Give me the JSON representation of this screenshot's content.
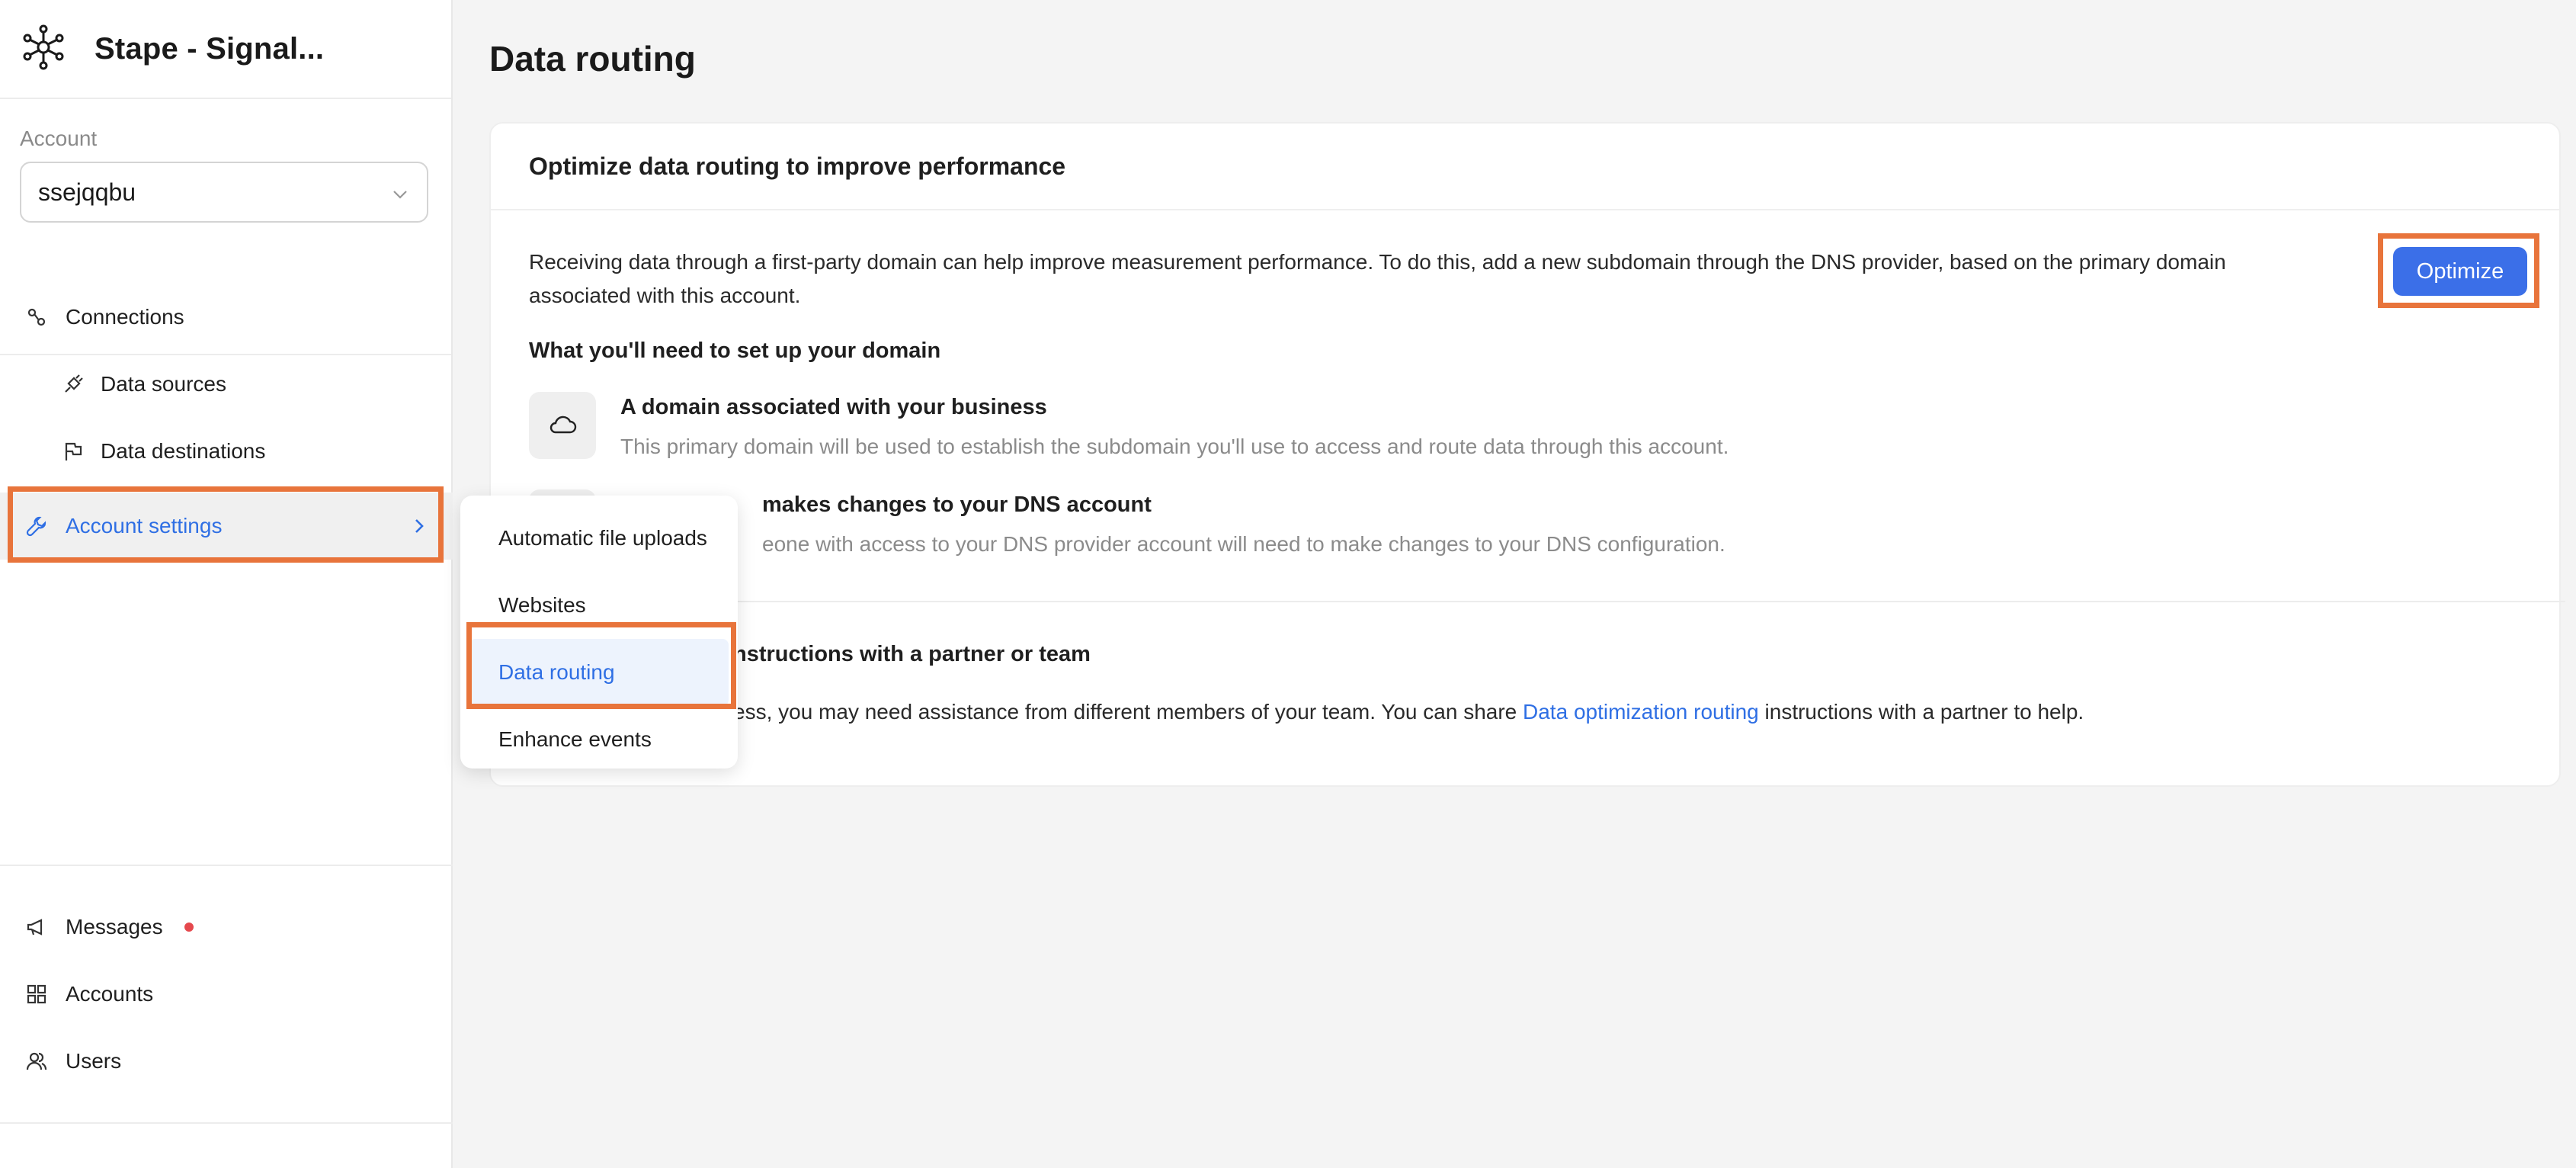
{
  "app": {
    "title": "Stape - Signal..."
  },
  "account": {
    "label": "Account",
    "selected": "ssejqqbu"
  },
  "sidebar": {
    "connections": "Connections",
    "data_sources": "Data sources",
    "data_destinations": "Data destinations",
    "account_settings": "Account settings",
    "messages": "Messages",
    "accounts": "Accounts",
    "users": "Users"
  },
  "submenu": {
    "items": [
      {
        "label": "Automatic file uploads"
      },
      {
        "label": "Websites"
      },
      {
        "label": "Data routing"
      },
      {
        "label": "Enhance events"
      }
    ]
  },
  "main": {
    "title": "Data routing",
    "card_title": "Optimize data routing to improve performance",
    "intro": "Receiving data through a first-party domain can help improve measurement performance. To do this, add a new subdomain through the DNS provider, based on the primary domain associated with this account.",
    "optimize_label": "Optimize",
    "need_title": "What you'll need to set up your domain",
    "features": [
      {
        "title": "A domain associated with your business",
        "desc": "This primary domain will be used to establish the subdomain you'll use to access and route data through this account."
      },
      {
        "title": "makes changes to your DNS account",
        "desc": "eone with access to your DNS provider account will need to make changes to your DNS configuration."
      }
    ],
    "share_title": "nstructions with a partner or team",
    "share_pre": "ess, you may need assistance from different members of your team. You can share ",
    "share_link": "Data optimization routing",
    "share_post": " instructions with a partner to help."
  },
  "colors": {
    "accent": "#3b6fe8",
    "highlight": "#e8743b",
    "notification_dot": "#e5484d"
  },
  "icons": {
    "brand": "network-hub-icon",
    "connections": "link-icon",
    "data_sources": "plug-icon",
    "data_destinations": "flag-icon",
    "account_settings": "wrench-icon",
    "messages": "megaphone-icon",
    "accounts": "grid-icon",
    "users": "users-icon",
    "domain": "cloud-icon"
  }
}
